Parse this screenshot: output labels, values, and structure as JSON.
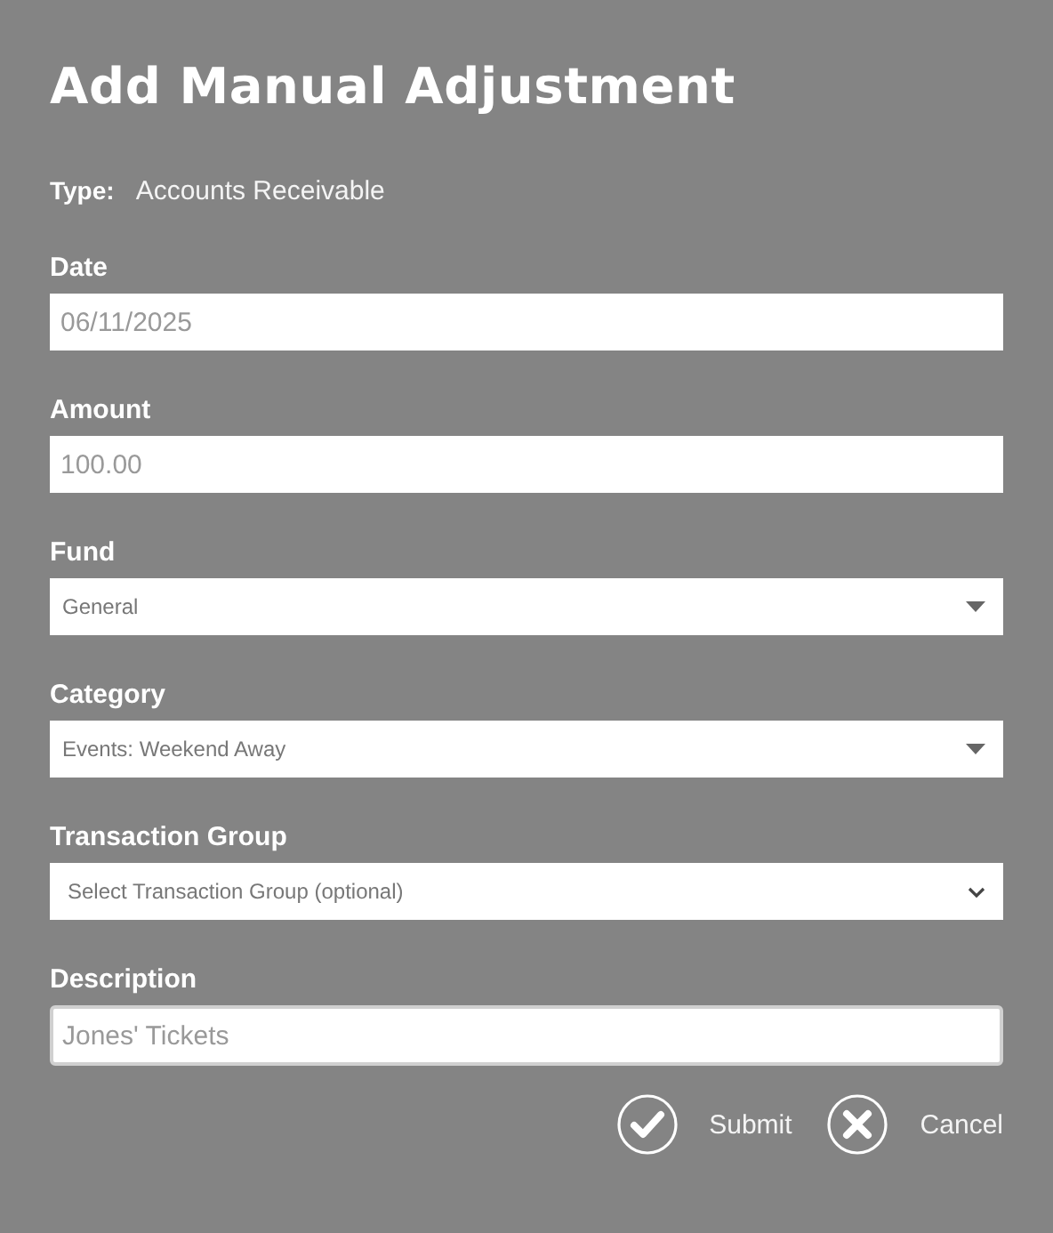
{
  "title": "Add Manual Adjustment",
  "type": {
    "label": "Type:",
    "value": "Accounts Receivable"
  },
  "fields": [
    {
      "label": "Date",
      "kind": "text",
      "value": "06/11/2025",
      "focused": false
    },
    {
      "label": "Amount",
      "kind": "text",
      "value": "100.00",
      "focused": false
    },
    {
      "label": "Fund",
      "kind": "select",
      "value": "General",
      "focused": false
    },
    {
      "label": "Category",
      "kind": "select",
      "value": "Events: Weekend Away",
      "focused": false
    },
    {
      "label": "Transaction Group",
      "kind": "native-select",
      "value": "Select Transaction Group (optional)",
      "focused": false
    },
    {
      "label": "Description",
      "kind": "text",
      "value": "Jones' Tickets",
      "focused": true
    }
  ],
  "buttons": [
    {
      "kind": "submit",
      "label": "Submit"
    },
    {
      "kind": "cancel",
      "label": "Cancel"
    }
  ]
}
